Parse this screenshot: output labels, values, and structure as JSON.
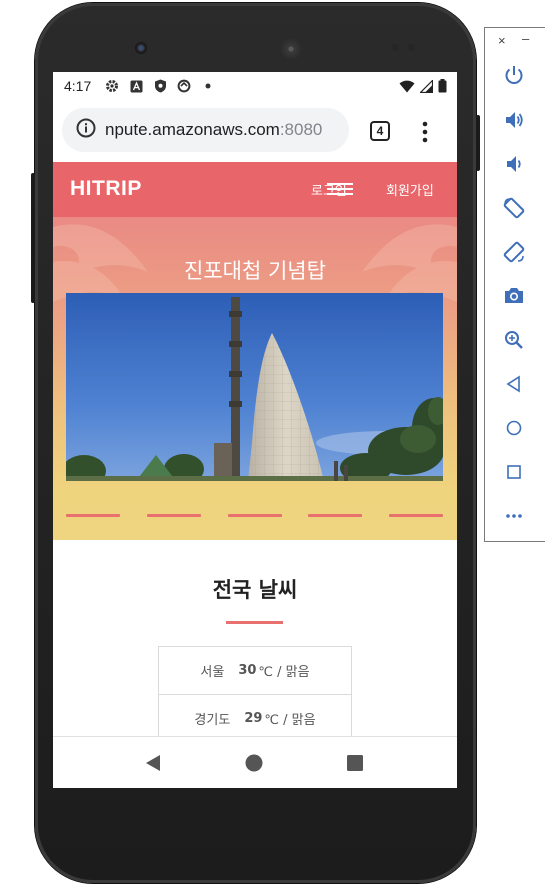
{
  "status_bar": {
    "time": "4:17"
  },
  "browser": {
    "url_host": "npute.amazonaws.com",
    "url_port": ":8080",
    "tab_count": "4"
  },
  "site": {
    "logo": "HITRIP",
    "nav_login": "로그인",
    "nav_signup": "회원가입",
    "hero_title": "진포대첩 기념탑",
    "weather_heading": "전국 날씨",
    "weather": [
      {
        "city": "서울",
        "temp": "30",
        "detail": "℃ / 맑음"
      },
      {
        "city": "경기도",
        "temp": "29",
        "detail": "℃ / 맑음"
      }
    ]
  },
  "colors": {
    "brand": "#e8666a",
    "accent_line": "#e8706e",
    "hero_top": "#ea8a84",
    "hero_bottom": "#efd580"
  },
  "icons": {
    "emulator_toolbar": [
      "close-icon",
      "minimize-icon",
      "power-icon",
      "volume-up-icon",
      "volume-down-icon",
      "rotate-left-icon",
      "rotate-right-icon",
      "camera-icon",
      "zoom-icon",
      "back-icon",
      "home-icon",
      "overview-icon",
      "more-icon"
    ],
    "android_nav": [
      "back-triangle-icon",
      "home-circle-icon",
      "recents-square-icon"
    ]
  }
}
